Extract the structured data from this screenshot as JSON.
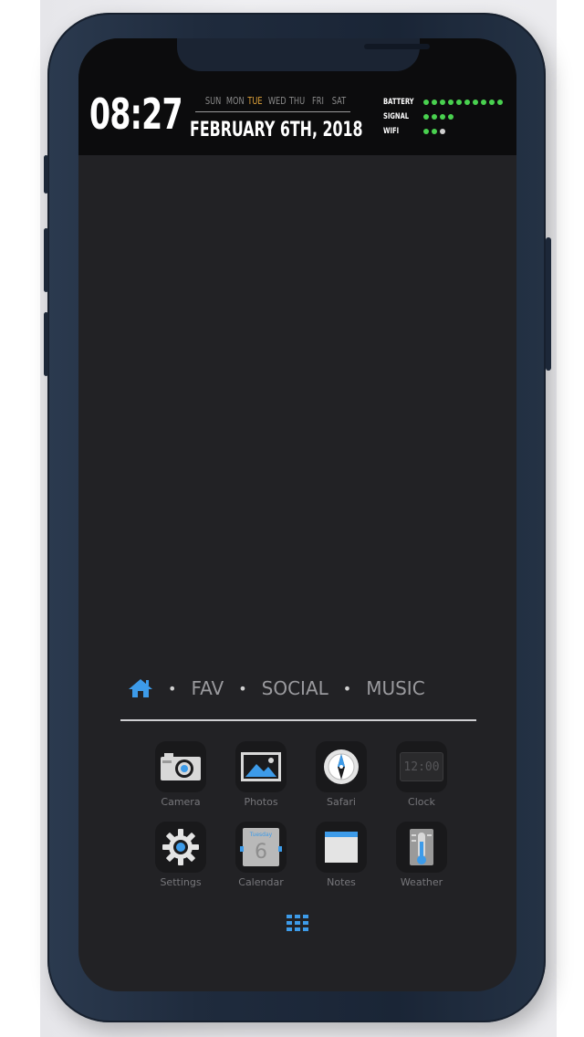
{
  "widget": {
    "time": "08:27",
    "days": [
      "SUN",
      "MON",
      "TUE",
      "WED",
      "THU",
      "FRI",
      "SAT"
    ],
    "active_day": "TUE",
    "date": "FEBRUARY 6TH, 2018",
    "stats": [
      {
        "label": "BATTERY",
        "level": 10,
        "max": 10
      },
      {
        "label": "SIGNAL",
        "level": 4,
        "max": 4
      },
      {
        "label": "WIFI",
        "level": 2,
        "max": 3
      }
    ]
  },
  "colors": {
    "accent_blue": "#3d9be9",
    "active_day": "#e0a33a",
    "status_green": "#49d14f",
    "dim_dot": "#cfcfcf"
  },
  "dock": {
    "tabs": [
      {
        "label": "FAV"
      },
      {
        "label": "SOCIAL"
      },
      {
        "label": "MUSIC"
      }
    ],
    "home_icon": "home-icon",
    "separator": "•"
  },
  "apps": [
    {
      "label": "Camera",
      "icon": "camera-icon"
    },
    {
      "label": "Photos",
      "icon": "photos-icon"
    },
    {
      "label": "Safari",
      "icon": "compass-icon"
    },
    {
      "label": "Clock",
      "icon": "clock-icon",
      "display": "12:00"
    },
    {
      "label": "Settings",
      "icon": "gear-icon"
    },
    {
      "label": "Calendar",
      "icon": "calendar-icon",
      "day_name": "Tuesday",
      "day_number": "6"
    },
    {
      "label": "Notes",
      "icon": "notes-icon"
    },
    {
      "label": "Weather",
      "icon": "thermometer-icon"
    }
  ],
  "app_drawer_icon": "grid-icon"
}
